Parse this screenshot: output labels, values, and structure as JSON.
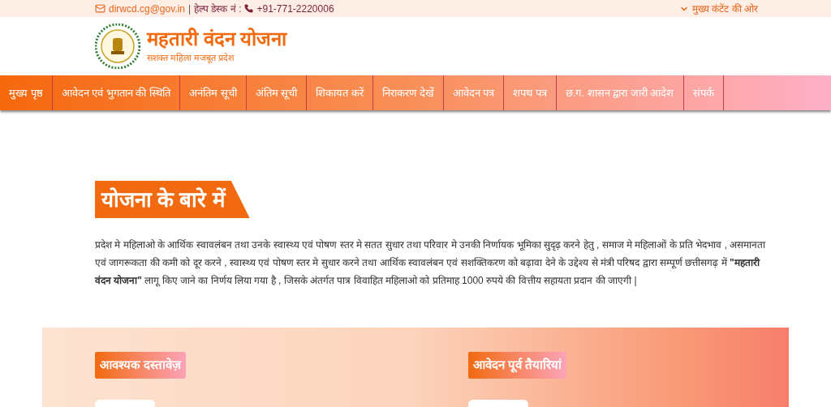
{
  "top_bar": {
    "email": "dirwcd.cg@gov.in",
    "separator": "|",
    "helpdesk_label": "हेल्प डेस्क नं :",
    "phone": "+91-771-2220006",
    "skip_link": "मुख्य कंटेंट की ओर"
  },
  "header": {
    "title": "महतारी वंदन योजना",
    "tagline": "सशक्त महिला मजबूत प्रदेश"
  },
  "nav": [
    "मुख्य पृष्ठ",
    "आवेदन एवं भुगतान की स्थिति",
    "अनंतिम सूची",
    "अंतिम सूची",
    "शिकायत करें",
    "निराकरण देखें",
    "आवेदन पत्र",
    "शपथ पत्र",
    "छ.ग. शासन द्वारा जारी आदेश",
    "संपर्क"
  ],
  "about": {
    "heading": "योजना के बारे में",
    "text": "प्रदेश मे महिलाओ के आर्थिक स्वावलंबन तथा उनके स्वास्थ्य एवं पोषण स्तर मे सतत सुधार तथा परिवार मे उनकी निर्णायक भूमिका सुदृढ़ करने हेतु , समाज मे महिलाओं के प्रति भेदभाव , असमानता एवं जागरूकता की कमी को दूर करने , स्वास्थ्य एवं पोषण स्तर मे सुधार करने तथा आर्थिक स्वावलंबन एवं सशक्तिकरण को बढ़ावा देने के उद्देश्य से मंत्री परिषद द्वारा सम्पूर्ण छत्तीसगढ़ में **\"महतारी वंदन योजना\"** लागू किए जाने का निर्णय लिया गया है , जिसके अंतर्गत पात्र विवाहित महिलाओ को प्रतिमाह 1000 रुपये की वित्तीय सहायता प्रदान की जाएगी |"
  },
  "sections": [
    {
      "heading": "आवश्यक दस्तावेज़"
    },
    {
      "heading": "आवेदन पूर्व तैयारियां"
    }
  ]
}
